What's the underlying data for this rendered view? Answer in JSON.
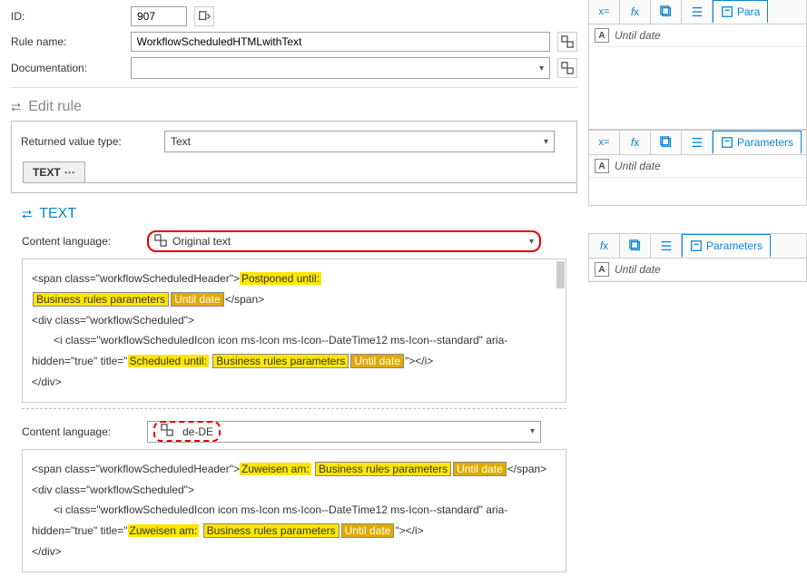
{
  "general": {
    "id_label": "ID:",
    "id_value": "907",
    "rule_name_label": "Rule name:",
    "rule_name_value": "WorkflowScheduledHTMLwithText",
    "documentation_label": "Documentation:",
    "documentation_value": ""
  },
  "edit_rule": {
    "title": "Edit rule",
    "returned_value_label": "Returned value type:",
    "returned_value": "Text",
    "tab_text": "TEXT"
  },
  "text_section": {
    "title": "TEXT",
    "content_lang_label": "Content language:",
    "lang1": "Original text",
    "lang2": "de-DE",
    "code1": {
      "l1_a": "<span class=\"workflowScheduledHeader\">",
      "l1_hl": "Postponed until:",
      "l2_brp": "Business rules parameters",
      "l2_token": "Until date",
      "l2_end": "</span>",
      "l3": "<div class=\"workflowScheduled\">",
      "l4_a": "<i class=\"workflowScheduledIcon icon ms-Icon ms-Icon--DateTime12 ms-Icon--standard\" aria-",
      "l5_a": "hidden=\"true\" title=\"",
      "l5_hl": "Scheduled until:",
      "l5_brp": "Business rules parameters",
      "l5_token": "Until date",
      "l5_end": "\"></i>",
      "l6": "</div>"
    },
    "code2": {
      "l1_a": "<span class=\"workflowScheduledHeader\">",
      "l1_hl": "Zuweisen am:",
      "l1_brp": "Business rules parameters",
      "l1_token": "Until date",
      "l1_end": "</span>",
      "l2": "<div class=\"workflowScheduled\">",
      "l3_a": "<i class=\"workflowScheduledIcon icon ms-Icon ms-Icon--DateTime12 ms-Icon--standard\" aria-",
      "l4_a": "hidden=\"true\" title=\"",
      "l4_hl": "Zuweisen am:",
      "l4_brp": "Business rules parameters",
      "l4_token": "Until date",
      "l4_end": "\"></i>",
      "l5": "</div>"
    }
  },
  "right": {
    "parameters_tab": "Parameters",
    "param_badge": "A",
    "param_name": "Until date",
    "param_name_partial": "Para"
  }
}
